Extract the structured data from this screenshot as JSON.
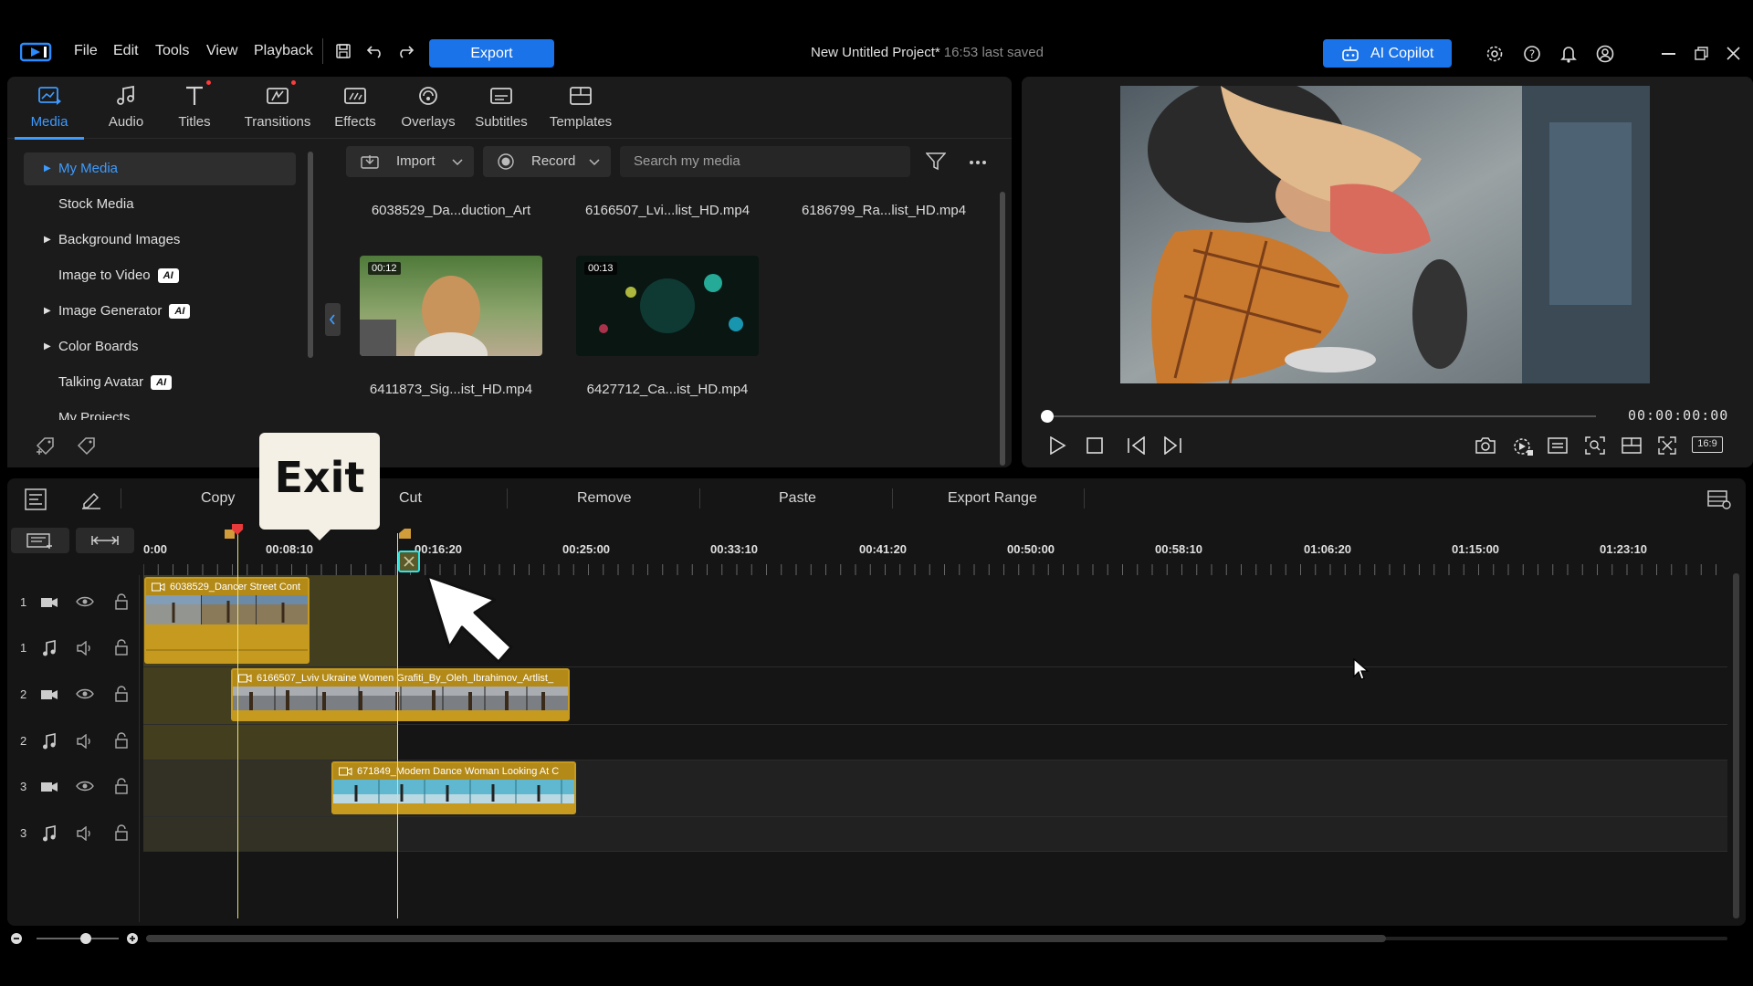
{
  "menu": {
    "file": "File",
    "edit": "Edit",
    "tools": "Tools",
    "view": "View",
    "playback": "Playback",
    "export_label": "Export"
  },
  "project": {
    "title": "New Untitled Project*",
    "saved": "16:53 last saved"
  },
  "copilot_label": "AI Copilot",
  "rooms": [
    {
      "label": "Media",
      "icon": "media-icon"
    },
    {
      "label": "Audio",
      "icon": "music-note-icon"
    },
    {
      "label": "Titles",
      "icon": "title-t-icon"
    },
    {
      "label": "Transitions",
      "icon": "transitions-icon"
    },
    {
      "label": "Effects",
      "icon": "effects-icon"
    },
    {
      "label": "Overlays",
      "icon": "overlays-icon"
    },
    {
      "label": "Subtitles",
      "icon": "subtitles-icon"
    },
    {
      "label": "Templates",
      "icon": "templates-icon"
    }
  ],
  "tree": {
    "my_media": "My Media",
    "stock_media": "Stock Media",
    "background_images": "Background Images",
    "image_to_video": "Image to Video",
    "image_generator": "Image Generator",
    "color_boards": "Color Boards",
    "talking_avatar": "Talking Avatar",
    "my_projects": "My Projects",
    "ai_badge": "AI"
  },
  "media_toolbar": {
    "import_label": "Import",
    "record_label": "Record",
    "search_placeholder": "Search my media"
  },
  "media_files": [
    {
      "name": "6038529_Da...duction_Art"
    },
    {
      "name": "6166507_Lvi...list_HD.mp4"
    },
    {
      "name": "6186799_Ra...list_HD.mp4"
    },
    {
      "name": "6411873_Sig...ist_HD.mp4",
      "duration": "00:12"
    },
    {
      "name": "6427712_Ca...ist_HD.mp4",
      "duration": "00:13"
    }
  ],
  "preview": {
    "timecode": "00:00:00:00",
    "aspect": "16:9"
  },
  "timeline_toolbar": {
    "copy": "Copy",
    "cut": "Cut",
    "remove": "Remove",
    "paste": "Paste",
    "export_range": "Export Range"
  },
  "ruler": [
    "0:00",
    "00:08:10",
    "00:16:20",
    "00:25:00",
    "00:33:10",
    "00:41:20",
    "00:50:00",
    "00:58:10",
    "01:06:20",
    "01:15:00",
    "01:23:10"
  ],
  "tracks": [
    "1",
    "1",
    "2",
    "2",
    "3",
    "3"
  ],
  "clips": [
    {
      "name": "6038529_Dancer Street Cont"
    },
    {
      "name": "6166507_Lviv Ukraine Women Grafiti_By_Oleh_Ibrahimov_Artlist_"
    },
    {
      "name": "671849_Modern Dance Woman Looking At C"
    }
  ],
  "overlay": {
    "exit_label": "Exit"
  },
  "colors": {
    "accent": "#1a73e8",
    "active_tab": "#3d9bff",
    "clip": "#c69a1e",
    "range_highlight": "#4a4520"
  }
}
